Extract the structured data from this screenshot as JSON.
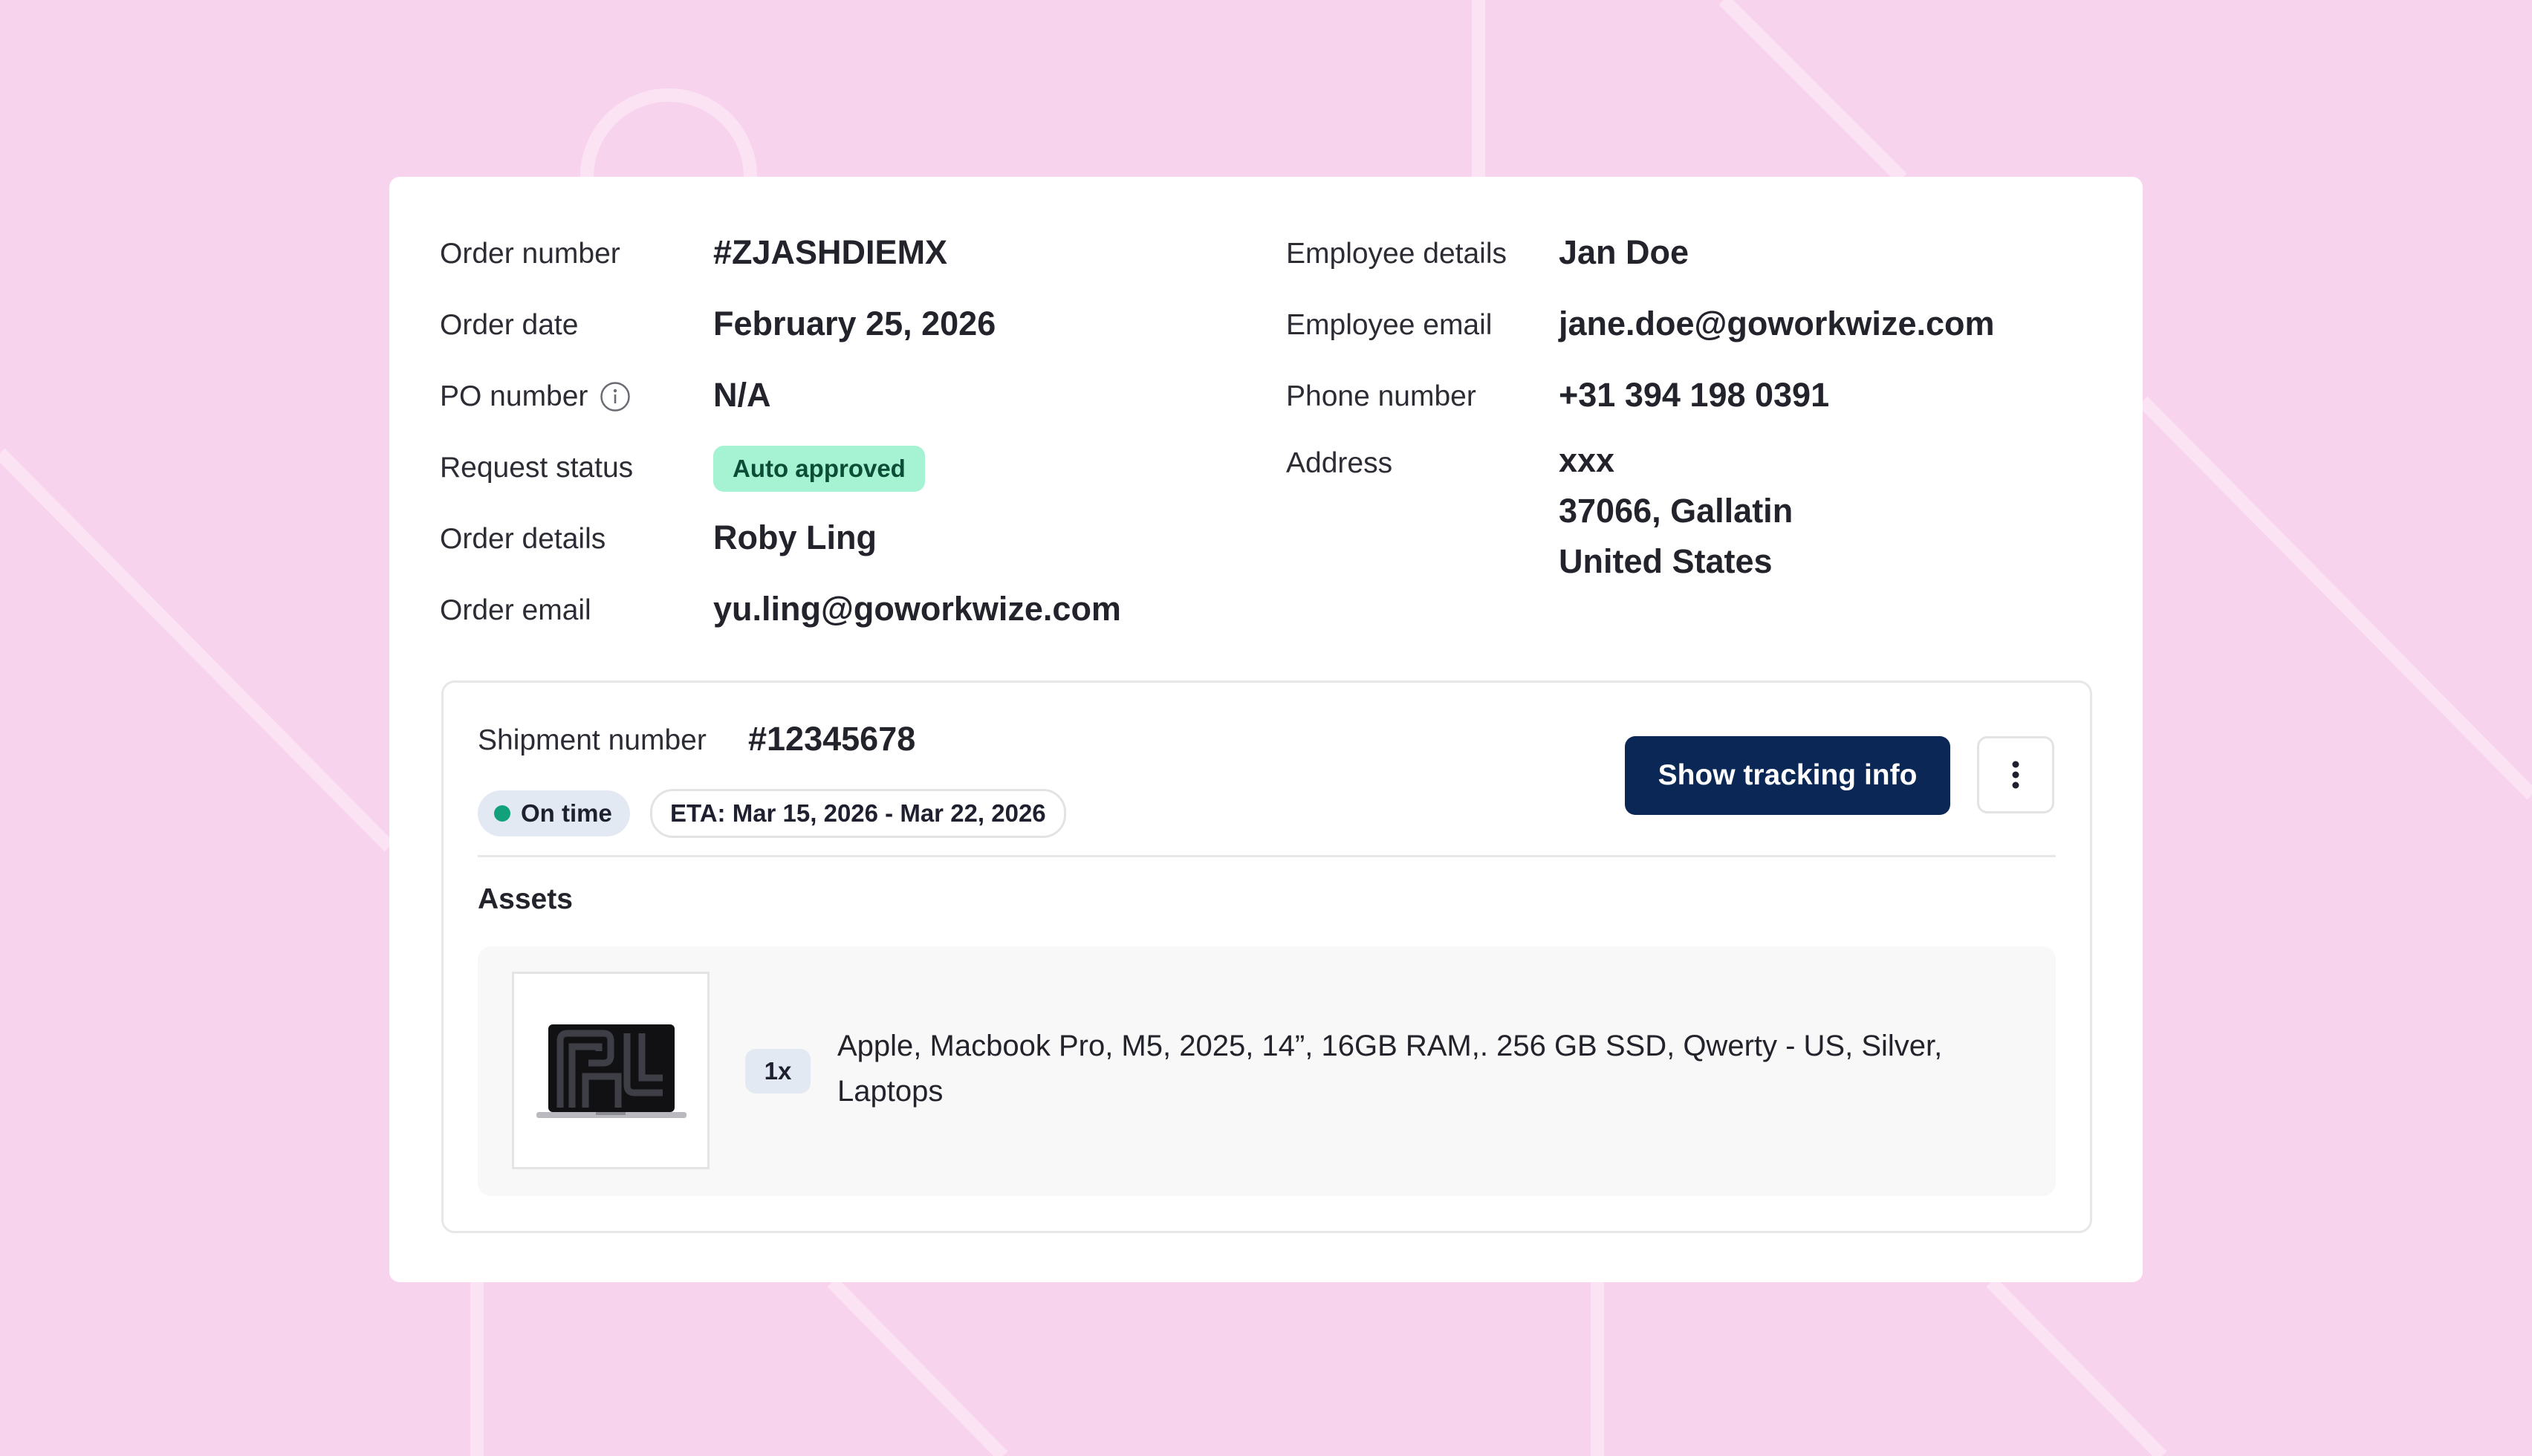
{
  "order": {
    "number_label": "Order number",
    "number_value": "#ZJASHDIEMX",
    "date_label": "Order date",
    "date_value": "February 25, 2026",
    "po_label": "PO number",
    "po_value": "N/A",
    "status_label": "Request status",
    "status_value": "Auto approved",
    "details_label": "Order details",
    "details_value": "Roby Ling",
    "email_label": "Order email",
    "email_value": "yu.ling@goworkwize.com"
  },
  "employee": {
    "details_label": "Employee details",
    "details_value": "Jan Doe",
    "email_label": "Employee email",
    "email_value": "jane.doe@goworkwize.com",
    "phone_label": "Phone number",
    "phone_value": "+31 394 198 0391",
    "address_label": "Address",
    "address_lines": [
      "xxx",
      "37066, Gallatin",
      "United States"
    ]
  },
  "shipment": {
    "number_label": "Shipment number",
    "number_value": "#12345678",
    "status": "On time",
    "eta": "ETA: Mar 15, 2026 - Mar 22, 2026",
    "track_button": "Show tracking info",
    "more_icon": "vertical-ellipsis-icon",
    "assets_title": "Assets",
    "assets": [
      {
        "quantity": "1x",
        "description": "Apple, Macbook Pro, M5, 2025, 14”, 16GB RAM,. 256 GB SSD, Qwerty - US, Silver, Laptops",
        "image_icon": "laptop-image"
      }
    ]
  },
  "colors": {
    "background": "#f8d3ee",
    "card": "#ffffff",
    "primary_button": "#0b2755",
    "approved_badge": "#a6f3d4",
    "on_time_dot": "#12a17a"
  }
}
